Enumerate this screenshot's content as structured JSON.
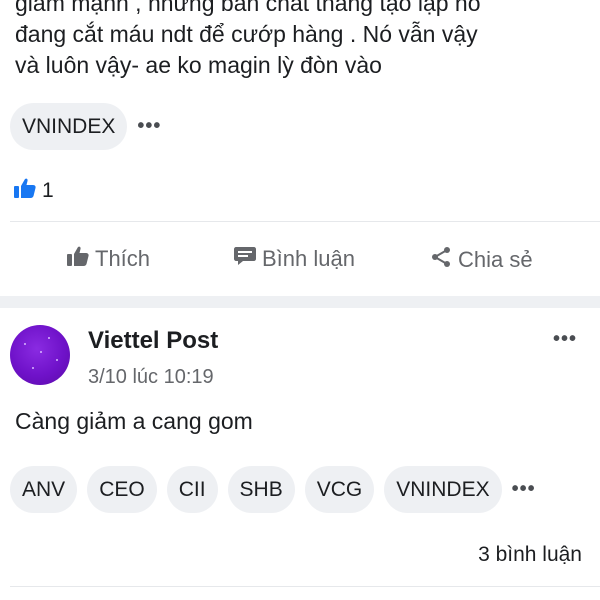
{
  "post1": {
    "text_lines": [
      "giảm mạnh , nhưng bản chất thằng tạo lập nó",
      "đang cắt máu ndt để cướp hàng . Nó vẫn vậy",
      "và luôn vậy- ae ko magin lỳ đòn vào"
    ],
    "tags": [
      "VNINDEX"
    ],
    "more_label": "•••",
    "like_count": "1"
  },
  "actions": {
    "like": "Thích",
    "comment": "Bình luận",
    "share": "Chia sẻ"
  },
  "post2": {
    "author": "Viettel Post",
    "timestamp": "3/10 lúc 10:19",
    "menu_label": "•••",
    "text": "Càng giảm a cang gom",
    "tags": [
      "ANV",
      "CEO",
      "CII",
      "SHB",
      "VCG",
      "VNINDEX"
    ],
    "more_label": "•••",
    "comments": "3 bình luận"
  },
  "colors": {
    "accent_blue": "#1877f2",
    "muted_text": "#65676b",
    "chip_bg": "#eef0f3",
    "avatar_purple": "#6f12c9"
  }
}
